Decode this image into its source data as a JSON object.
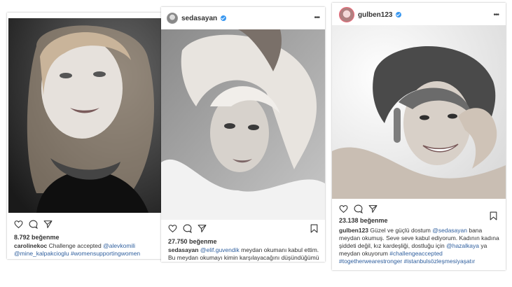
{
  "posts": [
    {
      "username": "",
      "likes": "8.792 beğenme",
      "caption_user": "carolinekoc",
      "caption_parts": [
        {
          "text": " Challenge accepted ",
          "tag": false
        },
        {
          "text": "@alevkomili",
          "tag": true
        },
        {
          "text": " ",
          "tag": false
        },
        {
          "text": "@mine_kalpakcioglu",
          "tag": true
        },
        {
          "text": " ",
          "tag": false
        },
        {
          "text": "#womensupportingwomen",
          "tag": true
        }
      ]
    },
    {
      "username": "sedasayan",
      "verified": true,
      "likes": "27.750 beğenme",
      "caption_user": "sedasayan",
      "caption_parts": [
        {
          "text": " ",
          "tag": false
        },
        {
          "text": "@elif.guvendik",
          "tag": true
        },
        {
          "text": " meydan okumanı kabul ettim. Bu meydan okumayı kimin karşılayacağını düşündüğümü",
          "tag": false
        }
      ]
    },
    {
      "username": "gulben123",
      "verified": true,
      "likes": "23.138 beğenme",
      "caption_user": "gulben123",
      "caption_parts": [
        {
          "text": " Güzel ve güçlü dostum ",
          "tag": false
        },
        {
          "text": "@sedasayan",
          "tag": true
        },
        {
          "text": " bana meydan okumuş. Seve seve kabul ediyorum. Kadının kadına şiddeti değil, kız kardeşliği, dostluğu için ",
          "tag": false
        },
        {
          "text": "@hazalkaya",
          "tag": true
        },
        {
          "text": " ya meydan okuyorum ",
          "tag": false
        },
        {
          "text": "#challengeaccepted",
          "tag": true
        },
        {
          "text": " ",
          "tag": false
        },
        {
          "text": "#togetherwearestronger",
          "tag": true
        },
        {
          "text": " ",
          "tag": false
        },
        {
          "text": "#istanbulsözleşmesiyaşatır",
          "tag": true
        }
      ]
    }
  ],
  "icons": [
    "heart-icon",
    "comment-icon",
    "share-icon",
    "bookmark-icon",
    "more-options-icon",
    "verified-badge-icon"
  ],
  "colors": {
    "tag": "#2f5f9e",
    "verified": "#3897f0"
  }
}
